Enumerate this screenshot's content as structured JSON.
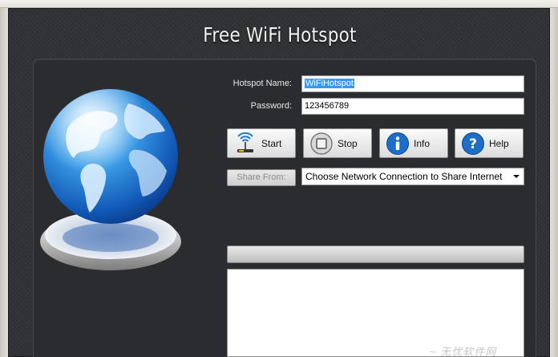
{
  "app": {
    "title": "Free WiFi Hotspot"
  },
  "form": {
    "hotspot_name_label": "Hotspot Name:",
    "hotspot_name_value": "WiFiHotspot",
    "password_label": "Password:",
    "password_value": "123456789"
  },
  "buttons": {
    "start": "Start",
    "stop": "Stop",
    "info": "Info",
    "help": "Help"
  },
  "share": {
    "button_label": "Share From:",
    "selected_option": "Choose Network Connection to Share Internet"
  },
  "progress": {
    "value_percent": 0
  },
  "watermark": {
    "text": "~ 无忧软件网"
  },
  "colors": {
    "background": "#303236",
    "selection": "#3399ff",
    "globe_blue": "#2f86d8"
  },
  "icons": {
    "start": "wifi-antenna-icon",
    "stop": "stop-square-icon",
    "info": "info-circle-icon",
    "help": "question-circle-icon",
    "logo": "globe-icon"
  }
}
